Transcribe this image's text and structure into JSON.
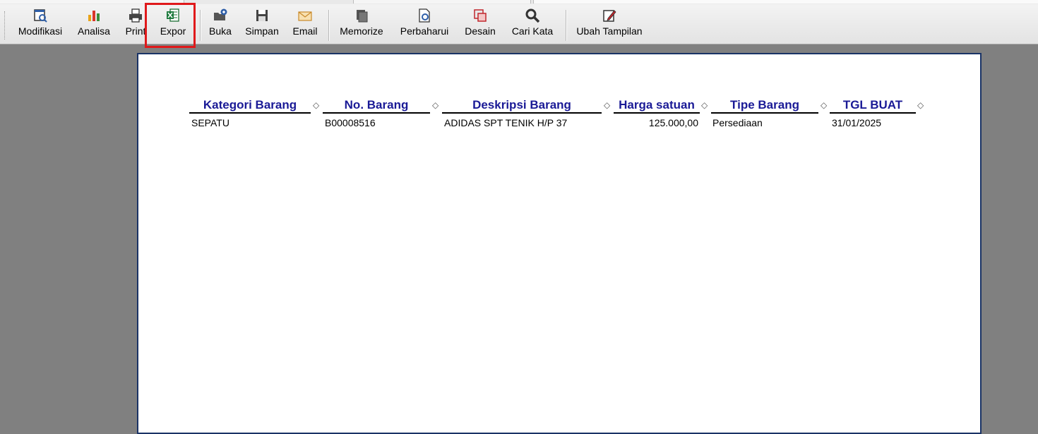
{
  "toolbar": {
    "modifikasi": "Modifikasi",
    "analisa": "Analisa",
    "print": "Print",
    "expor": "Expor",
    "buka": "Buka",
    "simpan": "Simpan",
    "email": "Email",
    "memorize": "Memorize",
    "perbaharui": "Perbaharui",
    "desain": "Desain",
    "cari_kata": "Cari Kata",
    "ubah_tampilan": "Ubah Tampilan"
  },
  "icons": {
    "modifikasi": "modify-report-icon",
    "analisa": "bar-chart-icon",
    "print": "printer-icon",
    "expor": "excel-icon",
    "buka": "open-folder-icon",
    "simpan": "floppy-save-icon",
    "email": "envelope-icon",
    "memorize": "memorize-icon",
    "perbaharui": "refresh-document-icon",
    "desain": "design-icon",
    "cari_kata": "magnifier-icon",
    "ubah_tampilan": "edit-pencil-icon"
  },
  "colors": {
    "header_text": "#1a1a96",
    "highlight": "#e0191b",
    "page_border": "#1a3366"
  },
  "report": {
    "columns": [
      "Kategori Barang",
      "No. Barang",
      "Deskripsi Barang",
      "Harga satuan",
      "Tipe Barang",
      "TGL BUAT"
    ],
    "rows": [
      [
        "SEPATU",
        "B00008516",
        "ADIDAS SPT TENIK H/P 37",
        "125.000,00",
        "Persediaan",
        "31/01/2025"
      ]
    ]
  }
}
